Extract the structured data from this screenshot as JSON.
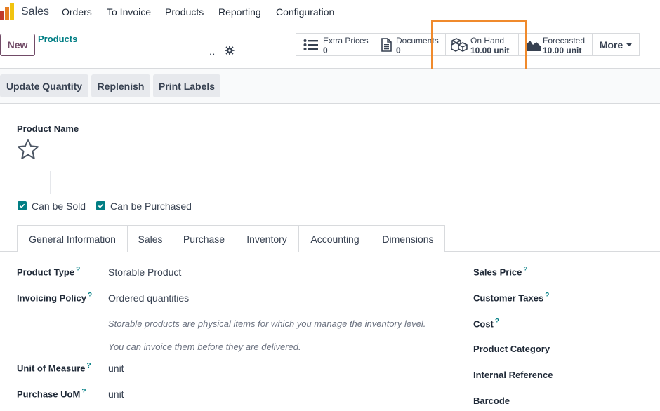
{
  "navbar": {
    "app_name": "Sales",
    "menu": [
      "Orders",
      "To Invoice",
      "Products",
      "Reporting",
      "Configuration"
    ]
  },
  "control_panel": {
    "new_label": "New",
    "breadcrumb": "Products",
    "record_dots": "..",
    "smart_buttons": [
      {
        "title": "Extra Prices",
        "value": "0",
        "icon": "list-icon"
      },
      {
        "title": "Documents",
        "value": "0",
        "icon": "document-icon"
      },
      {
        "title": "On Hand",
        "value": "10.00 unit",
        "icon": "cubes-icon"
      },
      {
        "title": "Forecasted",
        "value": "10.00 unit",
        "icon": "area-chart-icon"
      }
    ],
    "more_label": "More"
  },
  "actions": [
    "Update Quantity",
    "Replenish",
    "Print Labels"
  ],
  "form": {
    "product_name_label": "Product Name",
    "can_be_sold": "Can be Sold",
    "can_be_purchased": "Can be Purchased",
    "tabs": [
      "General Information",
      "Sales",
      "Purchase",
      "Inventory",
      "Accounting",
      "Dimensions"
    ],
    "left_fields": {
      "product_type_label": "Product Type",
      "product_type_value": "Storable Product",
      "invoicing_policy_label": "Invoicing Policy",
      "invoicing_policy_value": "Ordered quantities",
      "help_1": "Storable products are physical items for which you manage the inventory level.",
      "help_2": "You can invoice them before they are delivered.",
      "uom_label": "Unit of Measure",
      "uom_value": "unit",
      "purchase_uom_label": "Purchase UoM",
      "purchase_uom_value": "unit"
    },
    "right_fields": {
      "sales_price_label": "Sales Price",
      "customer_taxes_label": "Customer Taxes",
      "cost_label": "Cost",
      "product_category_label": "Product Category",
      "internal_reference_label": "Internal Reference",
      "barcode_label": "Barcode"
    },
    "help_marker": "?"
  },
  "colors": {
    "brand": "#714b67",
    "accent": "#017e84",
    "highlight": "#f08a2c"
  }
}
